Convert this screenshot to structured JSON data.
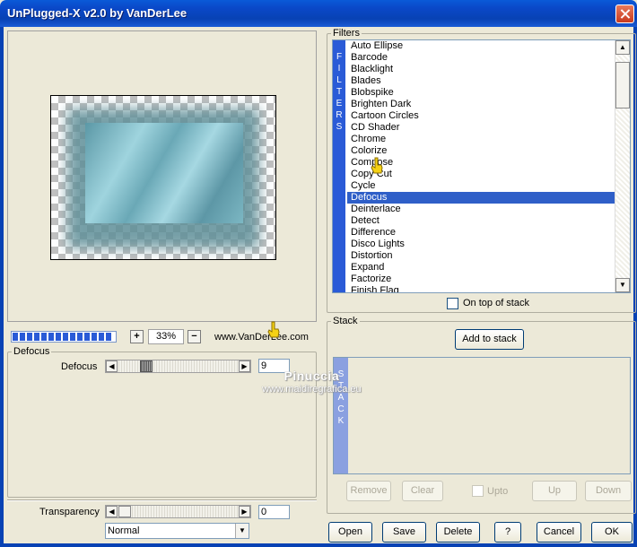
{
  "window": {
    "title": "UnPlugged-X v2.0 by VanDerLee"
  },
  "preview": {
    "zoom": "33%",
    "zoom_in": "+",
    "zoom_out": "−",
    "url": "www.VanDerLee.com"
  },
  "defocus_group": {
    "legend": "Defocus",
    "param_label": "Defocus",
    "param_value": "9",
    "transparency_label": "Transparency",
    "transparency_value": "0",
    "blend_mode": "Normal"
  },
  "filters_group": {
    "legend": "Filters",
    "vertical_tab": [
      "F",
      "I",
      "L",
      "T",
      "E",
      "R",
      "S"
    ],
    "items": [
      "Auto Ellipse",
      "Barcode",
      "Blacklight",
      "Blades",
      "Blobspike",
      "Brighten Dark",
      "Cartoon Circles",
      "CD Shader",
      "Chrome",
      "Colorize",
      "Compose",
      "Copy Cut",
      "Cycle",
      "Defocus",
      "Deinterlace",
      "Detect",
      "Difference",
      "Disco Lights",
      "Distortion",
      "Expand",
      "Factorize",
      "Finish Flag"
    ],
    "selected": "Defocus",
    "on_top_label": "On top of stack",
    "on_top_checked": false
  },
  "stack_group": {
    "legend": "Stack",
    "add_button": "Add to stack",
    "vertical_tab": [
      "S",
      "T",
      "A",
      "C",
      "K"
    ],
    "remove": "Remove",
    "clear": "Clear",
    "upto": "Upto",
    "up": "Up",
    "down": "Down"
  },
  "buttons": {
    "open": "Open",
    "save": "Save",
    "delete": "Delete",
    "help": "?",
    "cancel": "Cancel",
    "ok": "OK"
  },
  "watermark": {
    "line1": "Pinuccia",
    "line2": "www.maidiregrafica.eu"
  },
  "colors": {
    "titlebar": "#0842b4",
    "selection": "#2f5fc8",
    "filters_tab": "#2a5bd7",
    "stack_tab": "#8aa0e0"
  },
  "icons": [
    "close-icon",
    "hand-cursor-icon",
    "scroll-up-icon",
    "scroll-down-icon",
    "arrow-left-icon",
    "arrow-right-icon",
    "dropdown-icon"
  ]
}
